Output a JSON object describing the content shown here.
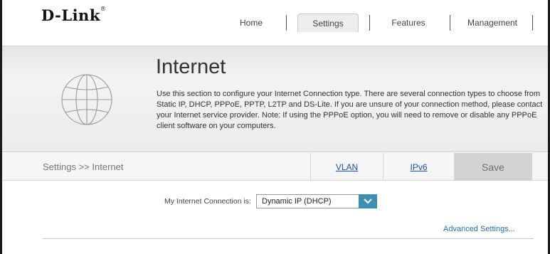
{
  "header": {
    "logo": "D-Link",
    "logo_mark": "®",
    "nav": [
      {
        "label": "Home"
      },
      {
        "label": "Settings"
      },
      {
        "label": "Features"
      },
      {
        "label": "Management"
      }
    ],
    "active_nav": "Settings"
  },
  "banner": {
    "title": "Internet",
    "icon": "globe-icon",
    "description": "Use this section to configure your Internet Connection type. There are several connection types to choose from Static IP, DHCP, PPPoE, PPTP, L2TP and DS-Lite. If you are unsure of your connection method, please contact your Internet service provider. Note: If using the PPPoE option, you will need to remove or disable any PPPoE client software on your computers."
  },
  "subbar": {
    "breadcrumb": "Settings >> Internet",
    "tabs": [
      {
        "label": "VLAN"
      },
      {
        "label": "IPv6"
      }
    ],
    "save_label": "Save"
  },
  "form": {
    "connection_label": "My Internet Connection is:",
    "connection_value": "Dynamic IP (DHCP)",
    "advanced_link": "Advanced Settings..."
  },
  "colors": {
    "accent": "#3f8fb3",
    "link": "#1a4fb4",
    "save_bg": "#d3d3d3"
  }
}
